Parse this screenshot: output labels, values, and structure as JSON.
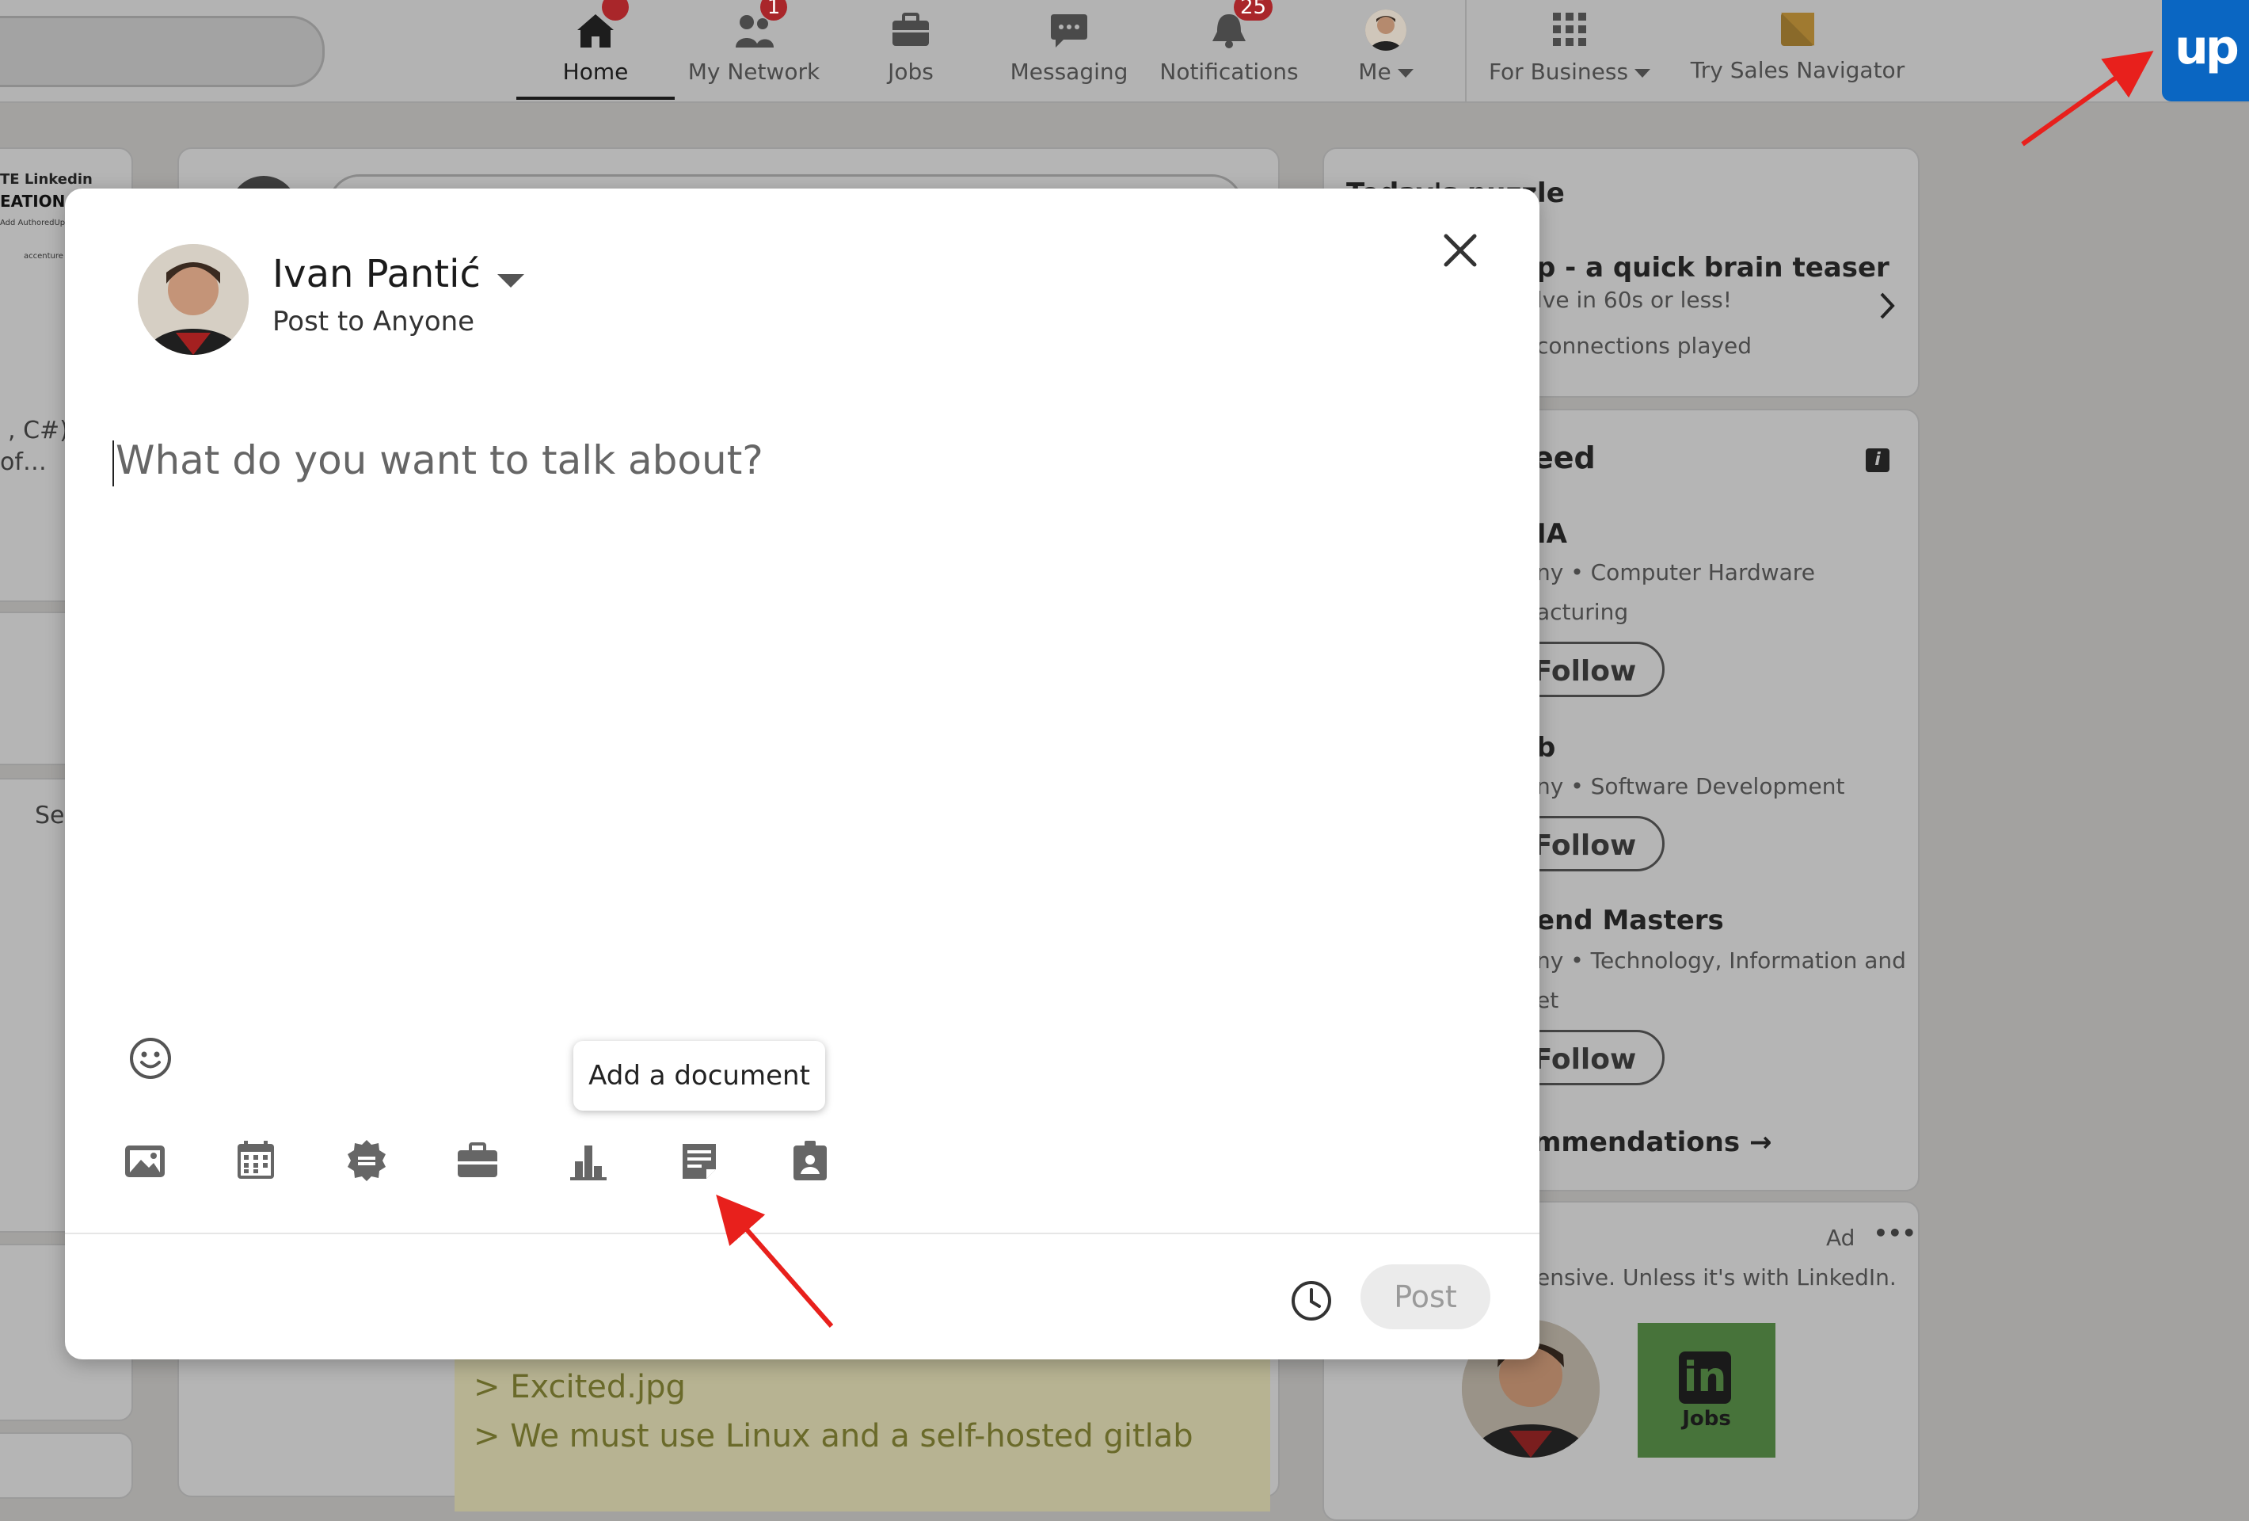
{
  "nav": {
    "items": [
      {
        "label": "Home",
        "icon": "home-icon",
        "badge": "",
        "active": true
      },
      {
        "label": "My Network",
        "icon": "people-icon",
        "badge": "1"
      },
      {
        "label": "Jobs",
        "icon": "briefcase-icon",
        "badge": ""
      },
      {
        "label": "Messaging",
        "icon": "chat-icon",
        "badge": ""
      },
      {
        "label": "Notifications",
        "icon": "bell-icon",
        "badge": "25"
      },
      {
        "label": "Me",
        "icon": "avatar",
        "badge": ""
      }
    ],
    "for_business": "For Business",
    "sales_navigator": "Try Sales Navigator"
  },
  "extension": {
    "logo_text": "up",
    "accent": "#0a66c2"
  },
  "background": {
    "left_banner_line1": "TE Linkedin",
    "left_banner_line2": "EATION",
    "left_banner_small": "Add AuthoredUp",
    "left_logos": "accenture",
    "left_text1": ", C#),",
    "left_text2": "of…",
    "left_see": "Se",
    "puzzle_title_frag": "Today's puzzle",
    "puzzle_heading": "p - a quick brain teaser",
    "puzzle_sub": "lve in 60s or less!",
    "puzzle_meta": "connections played",
    "feed_title": "eed",
    "companies": [
      {
        "name": "IA",
        "meta1": "ny • Computer Hardware",
        "meta2": "acturing",
        "follow": "Follow"
      },
      {
        "name": "b",
        "meta1": "ny • Software Development",
        "meta2": "",
        "follow": "Follow"
      },
      {
        "name": "end Masters",
        "meta1": "ny • Technology, Information and",
        "meta2": "et",
        "follow": "Follow"
      }
    ],
    "recommendations": "mmendations →",
    "ad_label": "Ad",
    "ad_more": "•••",
    "ad_text": "ensive. Unless it's with LinkedIn.",
    "jobs_logo_in": "in",
    "jobs_logo_text": "Jobs",
    "terminal_line1": "> Excited.jpg",
    "terminal_line2": "> We must use Linux and a self-hosted gitlab"
  },
  "composer": {
    "user_name": "Ivan Pantić",
    "audience": "Post to Anyone",
    "placeholder": "What do you want to talk about?",
    "tooltip": "Add a document",
    "tools": [
      "photo-icon",
      "event-icon",
      "celebrate-icon",
      "job-icon",
      "poll-icon",
      "document-icon",
      "hiring-icon"
    ],
    "post_label": "Post"
  },
  "colors": {
    "annotation_arrow": "#e8201c",
    "notification_badge": "#a9262a"
  }
}
